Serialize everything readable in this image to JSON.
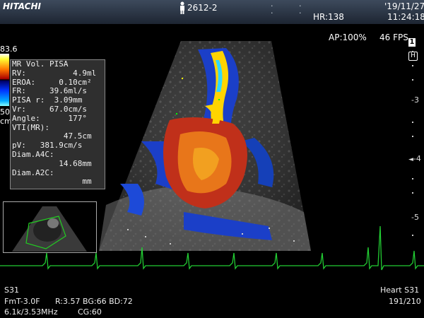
{
  "header": {
    "brand": "HITACHI",
    "patient_id": "2612-2",
    "hr": "HR:138",
    "date": "'19/11/27",
    "time": "11:24:18",
    "ap": "AP:100%",
    "fps": "46 FPS",
    "mode_number": "1",
    "mode_letter": "H"
  },
  "color_scale": {
    "top_value": "83.6",
    "bottom_value": "50",
    "bottom_unit": "cm"
  },
  "measurements": {
    "title": "MR Vol. PISA",
    "lines": [
      "RV:          4.9ml",
      "EROA:     0.10cm²",
      "FR:     39.6ml/s",
      "PISA r:  3.09mm",
      "Vr:     67.0cm/s",
      "Angle:      177°",
      "VTI(MR):",
      "           47.5cm",
      "pV:   381.9cm/s",
      "Diam.A4C:",
      "          14.68mm",
      "Diam.A2C:",
      "               mm"
    ]
  },
  "depth_scale": [
    "-3",
    "-4",
    "-5"
  ],
  "footer": {
    "probe": "S31",
    "mode": "FmT-3.0F",
    "params": "R:3.57  BG:66  BD:72",
    "freq": "6.1k/3.53MHz",
    "cg": "CG:60",
    "preset": "Heart S31",
    "frame": "191/210"
  },
  "colors": {
    "ecg": "#22cc33",
    "accent_yellow": "#ffd400",
    "flow_red": "#c0301a",
    "flow_blue": "#1b3fc8"
  }
}
